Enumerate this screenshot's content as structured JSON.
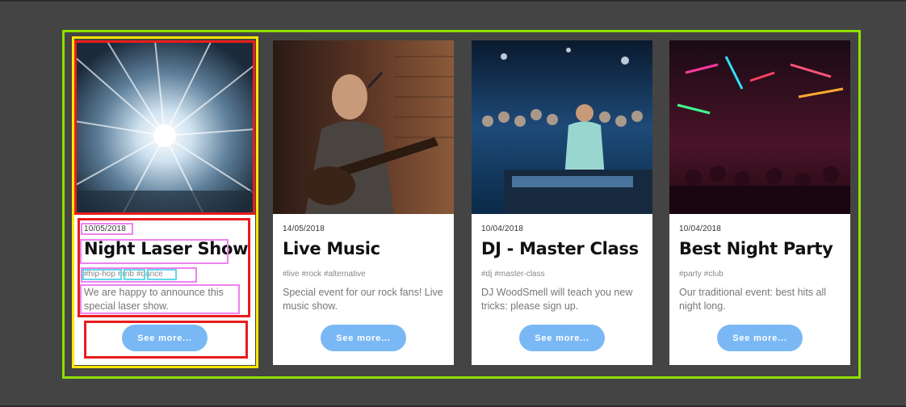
{
  "cards": [
    {
      "date": "10/05/2018",
      "title": "Night Laser Show",
      "tags": [
        "#hip-hop",
        "#rnb",
        "#dance"
      ],
      "description": "We are happy to announce this special laser show.",
      "button": "See more...",
      "image": "laser-light-photo"
    },
    {
      "date": "14/05/2018",
      "title": "Live Music",
      "tags": [
        "#live",
        "#rock",
        "#alternative"
      ],
      "description": "Special event for our rock fans! Live music show.",
      "button": "See more...",
      "image": "guitarist-photo"
    },
    {
      "date": "10/04/2018",
      "title": "DJ - Master Class",
      "tags": [
        "#dj",
        "#master-class"
      ],
      "description": "DJ WoodSmell will teach you new tricks: please sign up.",
      "button": "See more...",
      "image": "dj-crowd-photo"
    },
    {
      "date": "10/04/2018",
      "title": "Best Night Party",
      "tags": [
        "#party",
        "#club"
      ],
      "description": "Our traditional event: best hits all night long.",
      "button": "See more...",
      "image": "neon-street-photo"
    }
  ],
  "colors": {
    "background": "#444444",
    "outer_frame": "#8fe000",
    "button": "#7ab8f5",
    "highlight_yellow": "#ffe600",
    "highlight_red": "#e81c1c",
    "highlight_pink": "#ee82ee",
    "highlight_cyan": "#62d8e6"
  }
}
